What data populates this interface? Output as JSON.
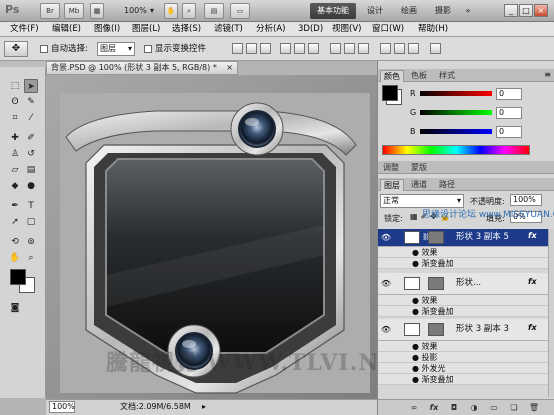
{
  "titlebar": {
    "logo": "Ps",
    "buttons": [
      "Br",
      "Mb"
    ],
    "zoom": "100%",
    "workspaces": [
      "基本功能",
      "设计",
      "绘画",
      "摄影"
    ],
    "window_controls": [
      "_",
      "□",
      "×"
    ]
  },
  "menu": [
    "文件(F)",
    "编辑(E)",
    "图像(I)",
    "图层(L)",
    "选择(S)",
    "滤镜(T)",
    "分析(A)",
    "3D(D)",
    "视图(V)",
    "窗口(W)",
    "帮助(H)"
  ],
  "options": {
    "auto_select_label": "自动选择:",
    "auto_select_value": "图层",
    "show_transform_label": "显示变换控件"
  },
  "document": {
    "tab_title": "背景.PSD @ 100% (形状 3 副本 5, RGB/8) *",
    "tab_close": "×",
    "zoom": "100%",
    "doc_size": "文档:2.09M/6.58M",
    "watermark": "騰龍視覺 WWW.TLVI.NET"
  },
  "color_panel": {
    "tabs": [
      "颜色",
      "色板",
      "样式"
    ],
    "channels": [
      {
        "label": "R",
        "value": "0"
      },
      {
        "label": "G",
        "value": "0"
      },
      {
        "label": "B",
        "value": "0"
      }
    ]
  },
  "layers_panel": {
    "tabs_top": [
      "调整",
      "蒙版"
    ],
    "tabs": [
      "图层",
      "通道",
      "路径"
    ],
    "blend_mode": "正常",
    "opacity_label": "不透明度:",
    "opacity_value": "100%",
    "lock_label": "锁定:",
    "fill_label": "填充:",
    "fill_value": "0%",
    "watermark": "思缘设计论坛 www.MISSYUAN.COM",
    "layers": [
      {
        "name": "形状 3 副本 5",
        "selected": true,
        "effects_label": "效果",
        "effects": [
          "渐变叠加"
        ]
      },
      {
        "name": "形状...",
        "selected": false,
        "effects_label": "效果",
        "effects": [
          "渐变叠加"
        ]
      },
      {
        "name": "形状 3 副本 3",
        "selected": false,
        "effects_label": "效果",
        "effects": [
          "投影",
          "外发光",
          "渐变叠加"
        ]
      }
    ],
    "bottom_icons": [
      "link-icon",
      "fx-icon",
      "mask-icon",
      "adjustment-icon",
      "folder-icon",
      "new-layer-icon",
      "trash-icon"
    ],
    "bottom_labels": [
      "∞",
      "fx",
      "◘",
      "◑",
      "▭",
      "❏",
      "🗑"
    ]
  },
  "colors": {
    "selected_layer": "#1d3a8a",
    "foreground": "#000000",
    "background": "#ffffff"
  }
}
